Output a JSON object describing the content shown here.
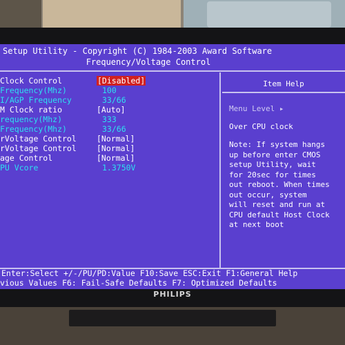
{
  "bios": {
    "title_line1": "Setup Utility - Copyright (C) 1984-2003 Award Software",
    "title_line2": "Frequency/Voltage Control",
    "rows": [
      {
        "label": " Clock Control",
        "value": "[Disabled]"
      },
      {
        "label": "  Frequency(Mhz)",
        "value": "100"
      },
      {
        "label": "I/AGP Frequency",
        "value": "33/66"
      },
      {
        "label": "M Clock ratio",
        "value": "[Auto]"
      },
      {
        "label": "requency(Mhz)",
        "value": "333"
      },
      {
        "label": " Frequency(Mhz)",
        "value": "33/66"
      },
      {
        "label": "rVoltage Control",
        "value": "[Normal]"
      },
      {
        "label": "rVoltage Control",
        "value": "[Normal]"
      },
      {
        "label": "age Control",
        "value": "[Normal]"
      },
      {
        "label": "PU Vcore",
        "value": "1.3750V"
      }
    ],
    "help": {
      "title": "Item Help",
      "menu_level": "Menu Level  ▸",
      "item_title": "Over CPU clock",
      "note": "Note: If system hangs\nup before enter CMOS\nsetup Utility, wait\nfor 20sec for times\nout reboot. When times\nout occur, system\nwill reset and run at\nCPU default Host Clock\nat next boot"
    },
    "footer_line1": "Enter:Select   +/-/PU/PD:Value  F10:Save   ESC:Exit  F1:General Help",
    "footer_line2": "vious Values      F6: Fail-Safe Defaults     F7: Optimized Defaults"
  },
  "monitor": {
    "brand": "PHILIPS"
  },
  "colors": {
    "screen_bg": "#5a3fcf",
    "value_cyan": "#2ee0f0",
    "highlight": "#d12020"
  }
}
